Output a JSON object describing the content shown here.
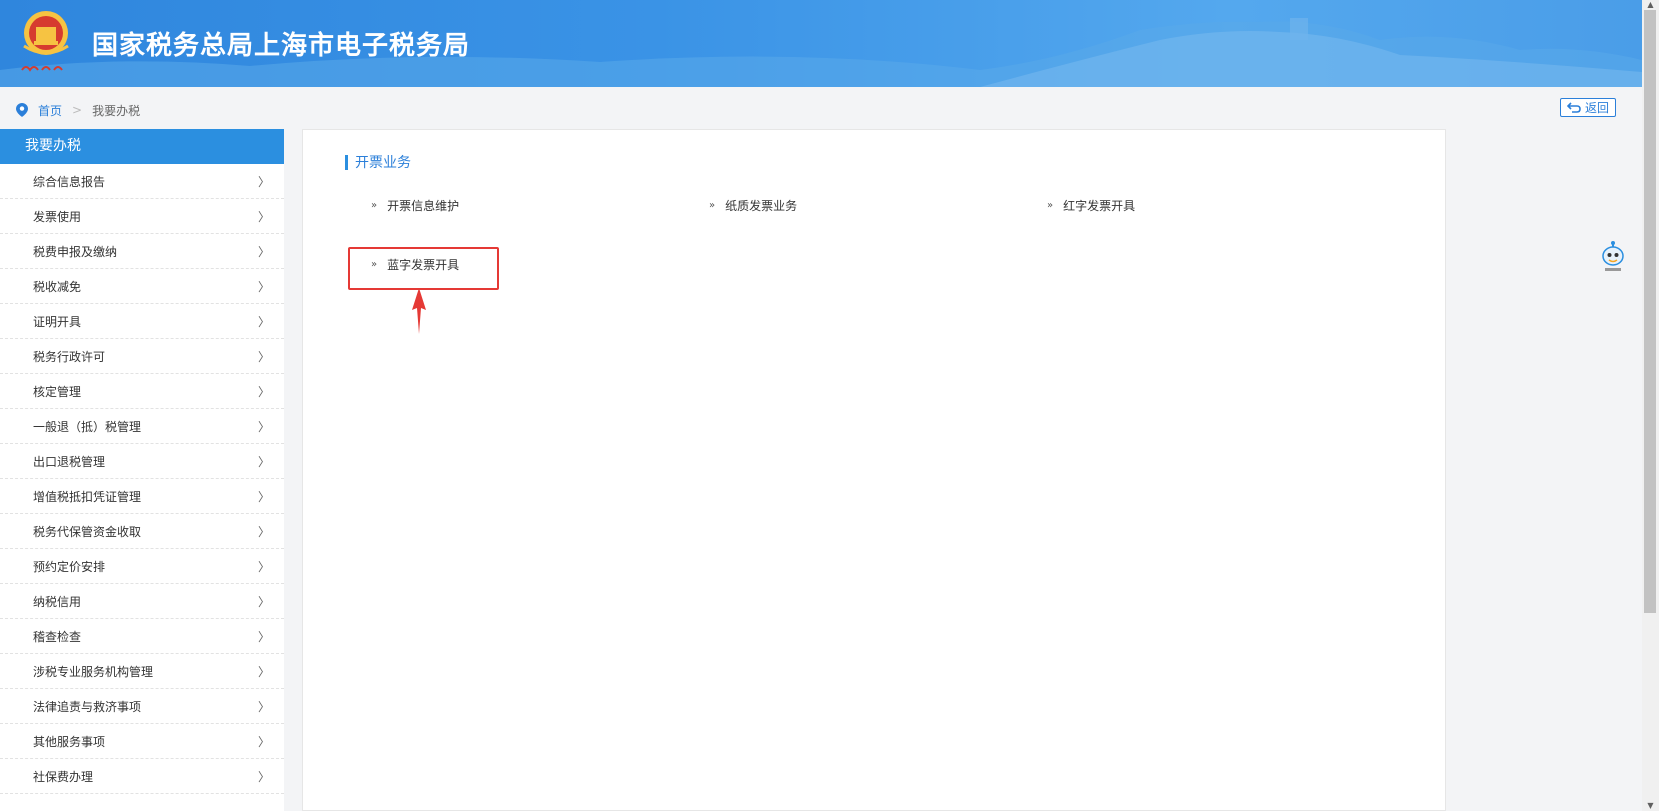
{
  "header": {
    "title": "国家税务总局上海市电子税务局"
  },
  "breadcrumb": {
    "home": "首页",
    "separator": ">",
    "current": "我要办税"
  },
  "back_button": {
    "label": "返回"
  },
  "sidebar": {
    "heading": "我要办税",
    "items": [
      {
        "label": "综合信息报告"
      },
      {
        "label": "发票使用"
      },
      {
        "label": "税费申报及缴纳"
      },
      {
        "label": "税收减免"
      },
      {
        "label": "证明开具"
      },
      {
        "label": "税务行政许可"
      },
      {
        "label": "核定管理"
      },
      {
        "label": "一般退（抵）税管理"
      },
      {
        "label": "出口退税管理"
      },
      {
        "label": "增值税抵扣凭证管理"
      },
      {
        "label": "税务代保管资金收取"
      },
      {
        "label": "预约定价安排"
      },
      {
        "label": "纳税信用"
      },
      {
        "label": "稽查检查"
      },
      {
        "label": "涉税专业服务机构管理"
      },
      {
        "label": "法律追责与救济事项"
      },
      {
        "label": "其他服务事项"
      },
      {
        "label": "社保费办理"
      }
    ],
    "chevron": "〉"
  },
  "main": {
    "section_title": "开票业务",
    "links": [
      {
        "label": "开票信息维护"
      },
      {
        "label": "纸质发票业务"
      },
      {
        "label": "红字发票开具"
      },
      {
        "label": "蓝字发票开具"
      }
    ],
    "bullet": "»"
  },
  "colors": {
    "accent": "#2b8fe0",
    "highlight_red": "#e53935",
    "header_bg": "#3a93e6"
  }
}
